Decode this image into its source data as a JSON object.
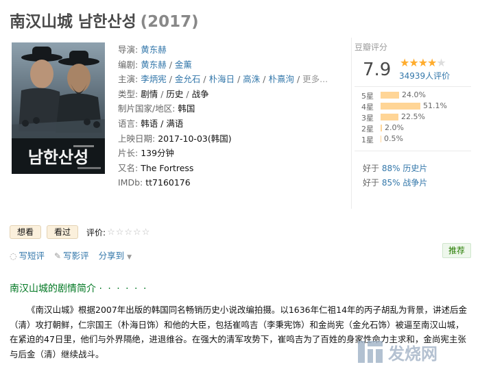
{
  "title": {
    "main": "南汉山城 남한산성",
    "year": "(2017)"
  },
  "poster": {
    "alt_text": "남한산성"
  },
  "info": {
    "director": {
      "label": "导演:",
      "names": [
        "黄东赫"
      ]
    },
    "writer": {
      "label": "编剧:",
      "names": [
        "黄东赫",
        "金薰"
      ]
    },
    "cast": {
      "label": "主演:",
      "names": [
        "李炳宪",
        "金允石",
        "朴海日",
        "高洙",
        "朴熹洵"
      ],
      "more": "更多..."
    },
    "genre": {
      "label": "类型:",
      "values": [
        "剧情",
        "历史",
        "战争"
      ]
    },
    "country": {
      "label": "制片国家/地区:",
      "value": "韩国"
    },
    "language": {
      "label": "语言:",
      "value": "韩语 / 满语"
    },
    "release": {
      "label": "上映日期:",
      "value": "2017-10-03(韩国)"
    },
    "runtime": {
      "label": "片长:",
      "value": "139分钟"
    },
    "aka": {
      "label": "又名:",
      "value": "The Fortress"
    },
    "imdb": {
      "label": "IMDb:",
      "value": "tt7160176"
    }
  },
  "rating": {
    "head": "豆瓣评分",
    "score": "7.9",
    "stars_filled": 4,
    "stars_total": 5,
    "votes": "34939人评价",
    "distribution": [
      {
        "label": "5星",
        "pct": "24.0%",
        "value": 24.0
      },
      {
        "label": "4星",
        "pct": "51.1%",
        "value": 51.1
      },
      {
        "label": "3星",
        "pct": "22.5%",
        "value": 22.5
      },
      {
        "label": "2星",
        "pct": "2.0%",
        "value": 2.0
      },
      {
        "label": "1星",
        "pct": "0.5%",
        "value": 0.5
      }
    ],
    "better": [
      {
        "prefix": "好于",
        "link": "88% 历史片"
      },
      {
        "prefix": "好于",
        "link": "85% 战争片"
      }
    ]
  },
  "actions": {
    "want": "想看",
    "seen": "看过",
    "rate_label": "评价:",
    "rate_stars": "☆☆☆☆☆"
  },
  "links": {
    "short_review": "写短评",
    "review": "写影评",
    "share": "分享到"
  },
  "recommend": "推荐",
  "section": {
    "heading": "南汉山城的剧情简介",
    "dots": "· · · · · ·"
  },
  "intro": "《南汉山城》根据2007年出版的韩国同名畅销历史小说改编拍摄。以1636年仁祖14年的丙子胡乱为背景，讲述后金（清）攻打朝鲜，仁宗国王（朴海日饰）和他的大臣，包括崔鸣吉（李秉宪饰）和金尚宪（金允石饰）被逼至南汉山城，在紧迫的47日里，他们与外界隔绝，进退维谷。在强大的清军攻势下，崔鸣吉为了百姓的身家性命力主求和，金尚宪主张与后金（清）继续战斗。",
  "watermark": {
    "text": "发烧网"
  },
  "colors": {
    "link": "#3377aa",
    "star": "#ffac2d",
    "bar": "#ffd596",
    "section_green": "#007722",
    "button_bg": "#fbf0dc"
  }
}
